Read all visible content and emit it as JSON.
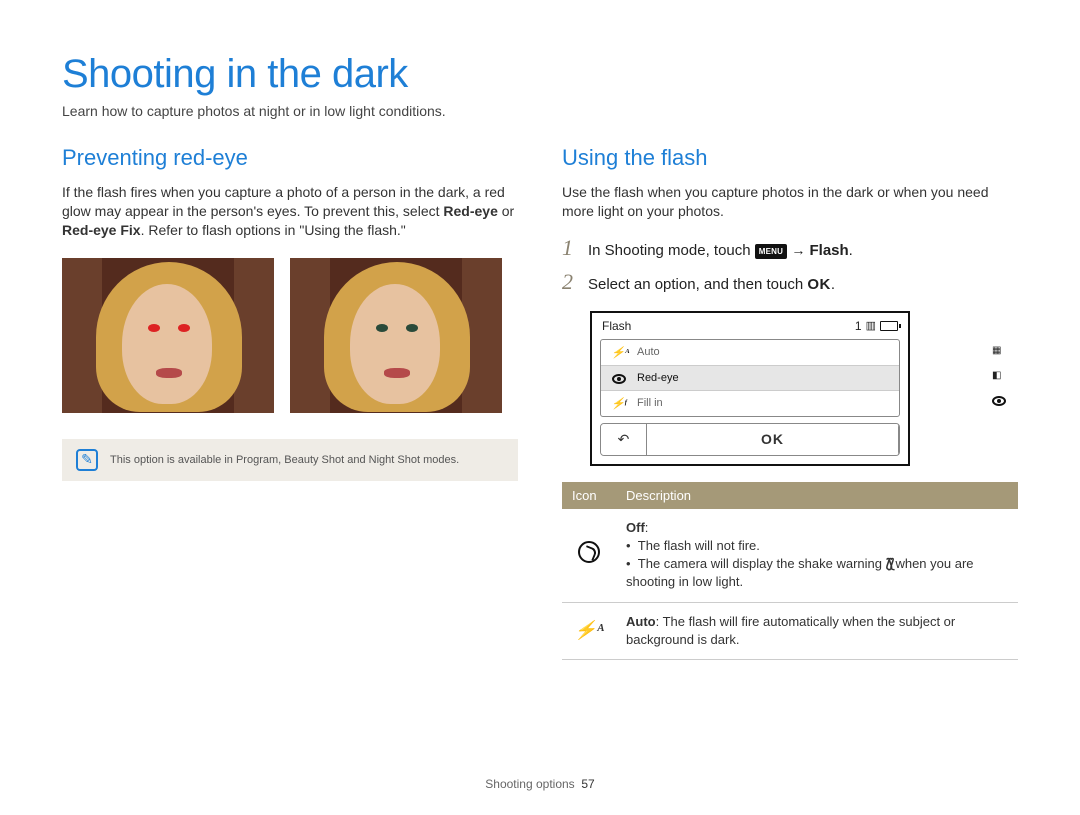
{
  "title": "Shooting in the dark",
  "intro": "Learn how to capture photos at night or in low light conditions.",
  "left": {
    "heading": "Preventing red-eye",
    "para_pre": "If the flash fires when you capture a photo of a person in the dark, a red glow may appear in the person's eyes. To prevent this, select ",
    "bold1": "Red-eye",
    "para_mid": " or ",
    "bold2": "Red-eye Fix",
    "para_post": ". Refer to flash options in \"Using the flash.\"",
    "note": "This option is available in Program, Beauty Shot and Night Shot modes."
  },
  "right": {
    "heading": "Using the flash",
    "para": "Use the flash when you capture photos in the dark or when you need more light on your photos.",
    "steps": {
      "s1_pre": "In Shooting mode, touch ",
      "s1_menu": "MENU",
      "s1_arrow": "→",
      "s1_bold": "Flash",
      "s1_end": ".",
      "s2_pre": "Select an option, and then touch ",
      "s2_ok": "OK",
      "s2_end": "."
    },
    "lcd": {
      "title": "Flash",
      "count": "1",
      "items": [
        "Auto",
        "Red-eye",
        "Fill in"
      ],
      "back": "↶",
      "ok": "OK"
    },
    "table": {
      "h_icon": "Icon",
      "h_desc": "Description",
      "row1_title": "Off",
      "row1_b1": "The flash will not fire.",
      "row1_b2a": "The camera will display the shake warning ",
      "row1_b2b": " when you are shooting in low light.",
      "row2_title": "Auto",
      "row2_text": ": The flash will fire automatically when the subject or background is dark."
    }
  },
  "footer": {
    "section": "Shooting options",
    "page": "57"
  }
}
